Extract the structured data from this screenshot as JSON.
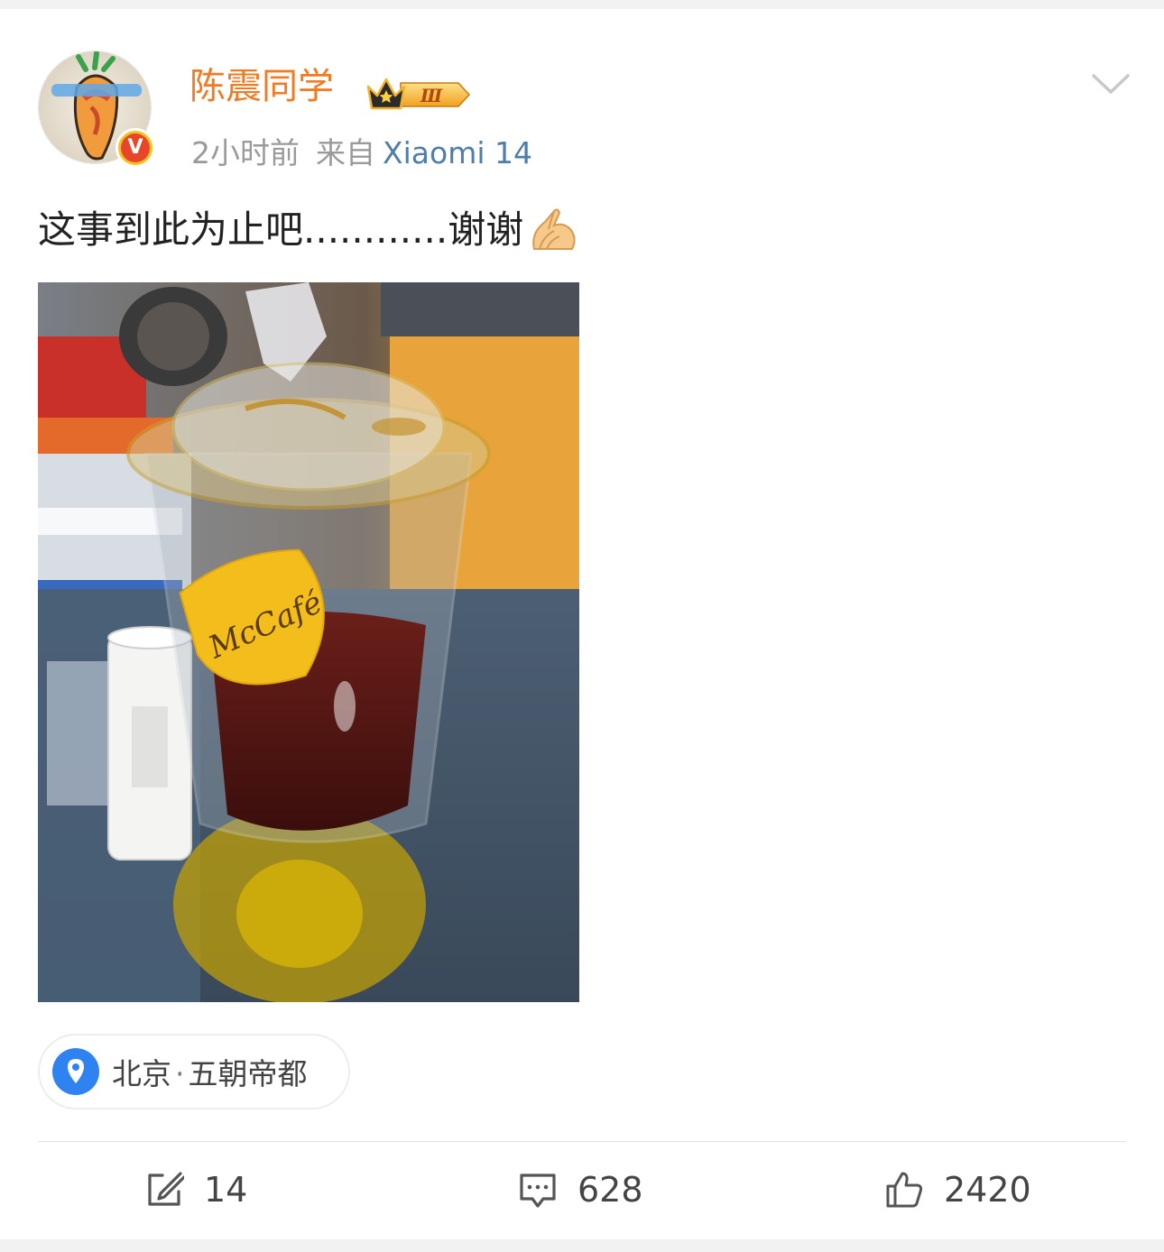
{
  "post": {
    "username": "陈震同学",
    "vip_level": "Ⅲ",
    "verified_mark": "V",
    "time": "2小时前",
    "source_prefix": "来自",
    "device": "Xiaomi 14",
    "text": "这事到此为止吧............谢谢",
    "text_emoji": "pinched-hands-icon",
    "photo_logo_text": "McCafé",
    "location": {
      "city": "北京",
      "separator": "·",
      "tagline": "五朝帝都"
    }
  },
  "actions": {
    "repost_count": "14",
    "comment_count": "628",
    "like_count": "2420"
  },
  "colors": {
    "username": "#f07b22",
    "device_link": "#4f7ea8",
    "meta": "#9a9a9a",
    "pin": "#2f83f0",
    "verified": "#e8462b"
  }
}
